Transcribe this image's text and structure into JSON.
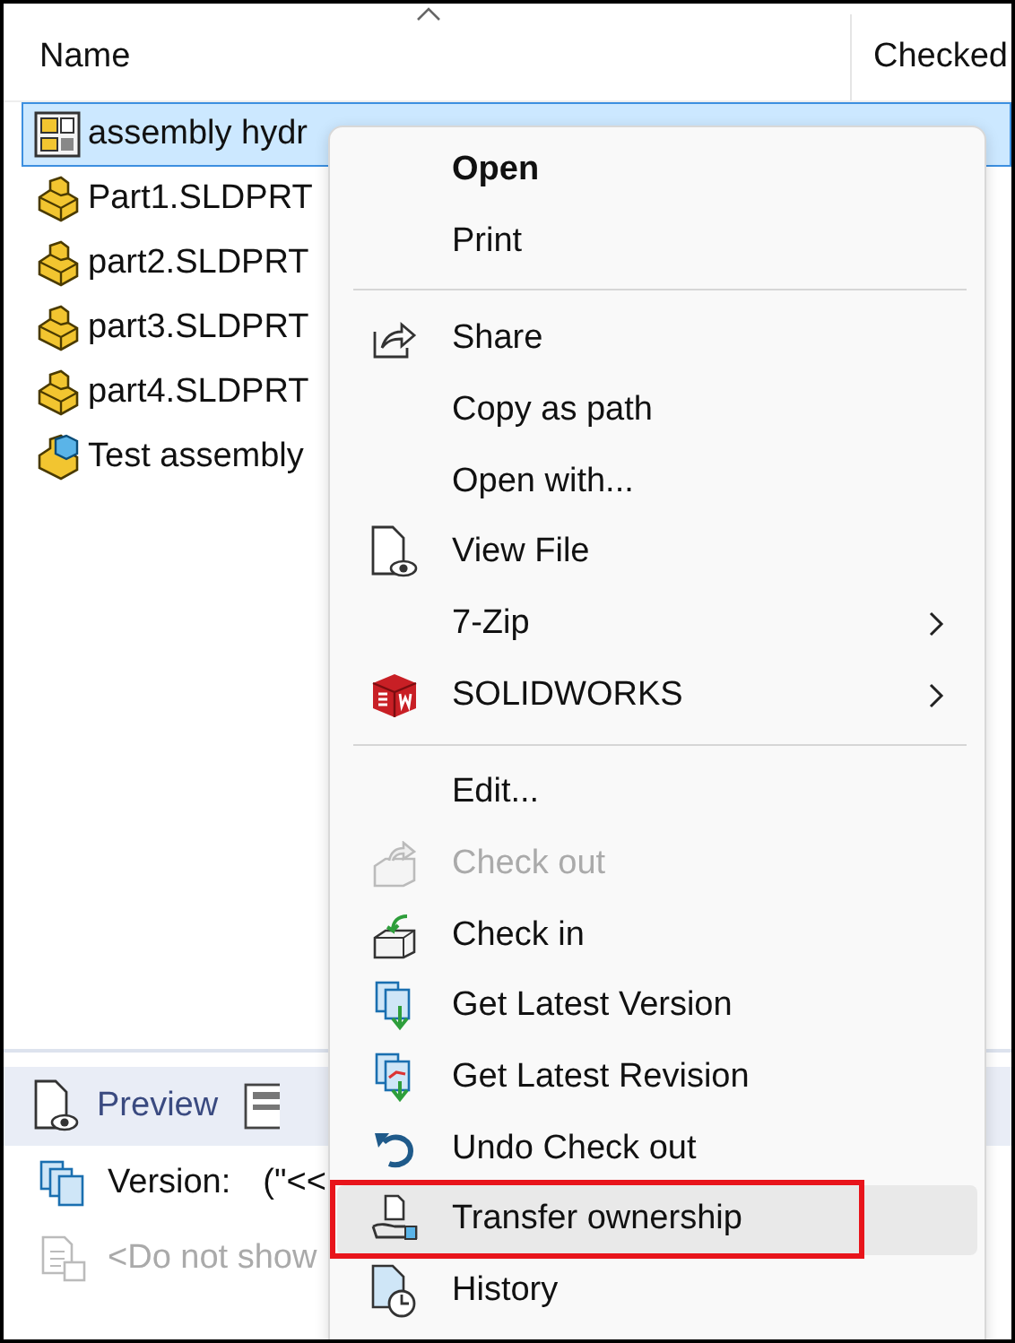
{
  "columns": [
    {
      "label": "Name",
      "sorted": true
    },
    {
      "label": "Checked"
    }
  ],
  "files": [
    {
      "name": "assembly hydr",
      "kind": "drawing",
      "selected": true
    },
    {
      "name": "Part1.SLDPRT",
      "kind": "part",
      "selected": false
    },
    {
      "name": "part2.SLDPRT",
      "kind": "part",
      "selected": false
    },
    {
      "name": "part3.SLDPRT",
      "kind": "part",
      "selected": false
    },
    {
      "name": "part4.SLDPRT",
      "kind": "part",
      "selected": false
    },
    {
      "name": "Test assembly",
      "kind": "assembly",
      "selected": false
    }
  ],
  "bottom_panel": {
    "tabs": [
      {
        "label": "Preview"
      }
    ],
    "version_label": "Version:",
    "version_value": "(\"<<",
    "hint": "<Do not show"
  },
  "context_menu": [
    {
      "kind": "item",
      "label": "Open",
      "bold": true,
      "disabled": false,
      "submenu": false,
      "hovered": false,
      "marked": false
    },
    {
      "kind": "item",
      "label": "Print",
      "bold": false,
      "disabled": false,
      "submenu": false,
      "hovered": false,
      "marked": false
    },
    {
      "kind": "separator"
    },
    {
      "kind": "item",
      "label": "Share",
      "bold": false,
      "disabled": false,
      "submenu": false,
      "hovered": false,
      "marked": false
    },
    {
      "kind": "item",
      "label": "Copy as path",
      "bold": false,
      "disabled": false,
      "submenu": false,
      "hovered": false,
      "marked": false
    },
    {
      "kind": "item",
      "label": "Open with...",
      "bold": false,
      "disabled": false,
      "submenu": false,
      "hovered": false,
      "marked": false
    },
    {
      "kind": "item",
      "label": "View File",
      "bold": false,
      "disabled": false,
      "submenu": false,
      "hovered": false,
      "marked": false
    },
    {
      "kind": "item",
      "label": "7-Zip",
      "bold": false,
      "disabled": false,
      "submenu": true,
      "hovered": false,
      "marked": false
    },
    {
      "kind": "item",
      "label": "SOLIDWORKS",
      "bold": false,
      "disabled": false,
      "submenu": true,
      "hovered": false,
      "marked": false
    },
    {
      "kind": "separator"
    },
    {
      "kind": "item",
      "label": "Edit...",
      "bold": false,
      "disabled": false,
      "submenu": false,
      "hovered": false,
      "marked": false
    },
    {
      "kind": "item",
      "label": "Check out",
      "bold": false,
      "disabled": true,
      "submenu": false,
      "hovered": false,
      "marked": false
    },
    {
      "kind": "item",
      "label": "Check in",
      "bold": false,
      "disabled": false,
      "submenu": false,
      "hovered": false,
      "marked": false
    },
    {
      "kind": "item",
      "label": "Get Latest Version",
      "bold": false,
      "disabled": false,
      "submenu": false,
      "hovered": false,
      "marked": false
    },
    {
      "kind": "item",
      "label": "Get Latest Revision",
      "bold": false,
      "disabled": false,
      "submenu": false,
      "hovered": false,
      "marked": false
    },
    {
      "kind": "item",
      "label": "Undo Check out",
      "bold": false,
      "disabled": false,
      "submenu": false,
      "hovered": false,
      "marked": false
    },
    {
      "kind": "item",
      "label": "Transfer ownership",
      "bold": false,
      "disabled": false,
      "submenu": false,
      "hovered": true,
      "marked": true
    },
    {
      "kind": "item",
      "label": "History",
      "bold": false,
      "disabled": false,
      "submenu": false,
      "hovered": false,
      "marked": false
    }
  ]
}
